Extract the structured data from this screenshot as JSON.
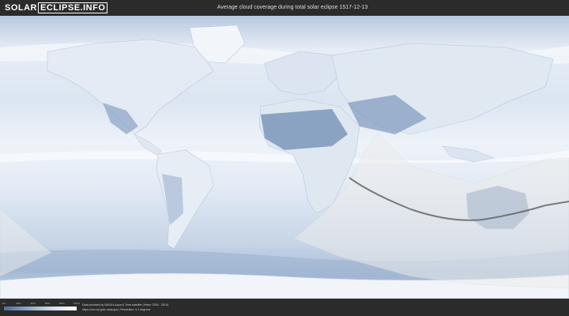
{
  "header": {
    "logo_left": "SOLAR",
    "logo_right": "ECLIPSE.INFO",
    "title": "Average cloud coverage during total solar eclipse 1517-12-13"
  },
  "footer": {
    "scale_ticks": [
      "0%",
      "20%",
      "40%",
      "60%",
      "80%",
      "100%"
    ],
    "credit_line1": "Data provided by NASA's Aqua & Terra satellite (Years: 2000 - 2019)",
    "credit_line2": "https://neo.sci.gsfc.nasa.gov | Resolution: 0.1 degrees"
  },
  "map": {
    "colors": {
      "clear": "#f4f7fb",
      "low_cloud": "#cfdbea",
      "mid_cloud": "#9fb4d0",
      "heavy_cloud": "#6a88b0",
      "path_fill": "#e8e8e8",
      "central_line": "#555555"
    }
  }
}
